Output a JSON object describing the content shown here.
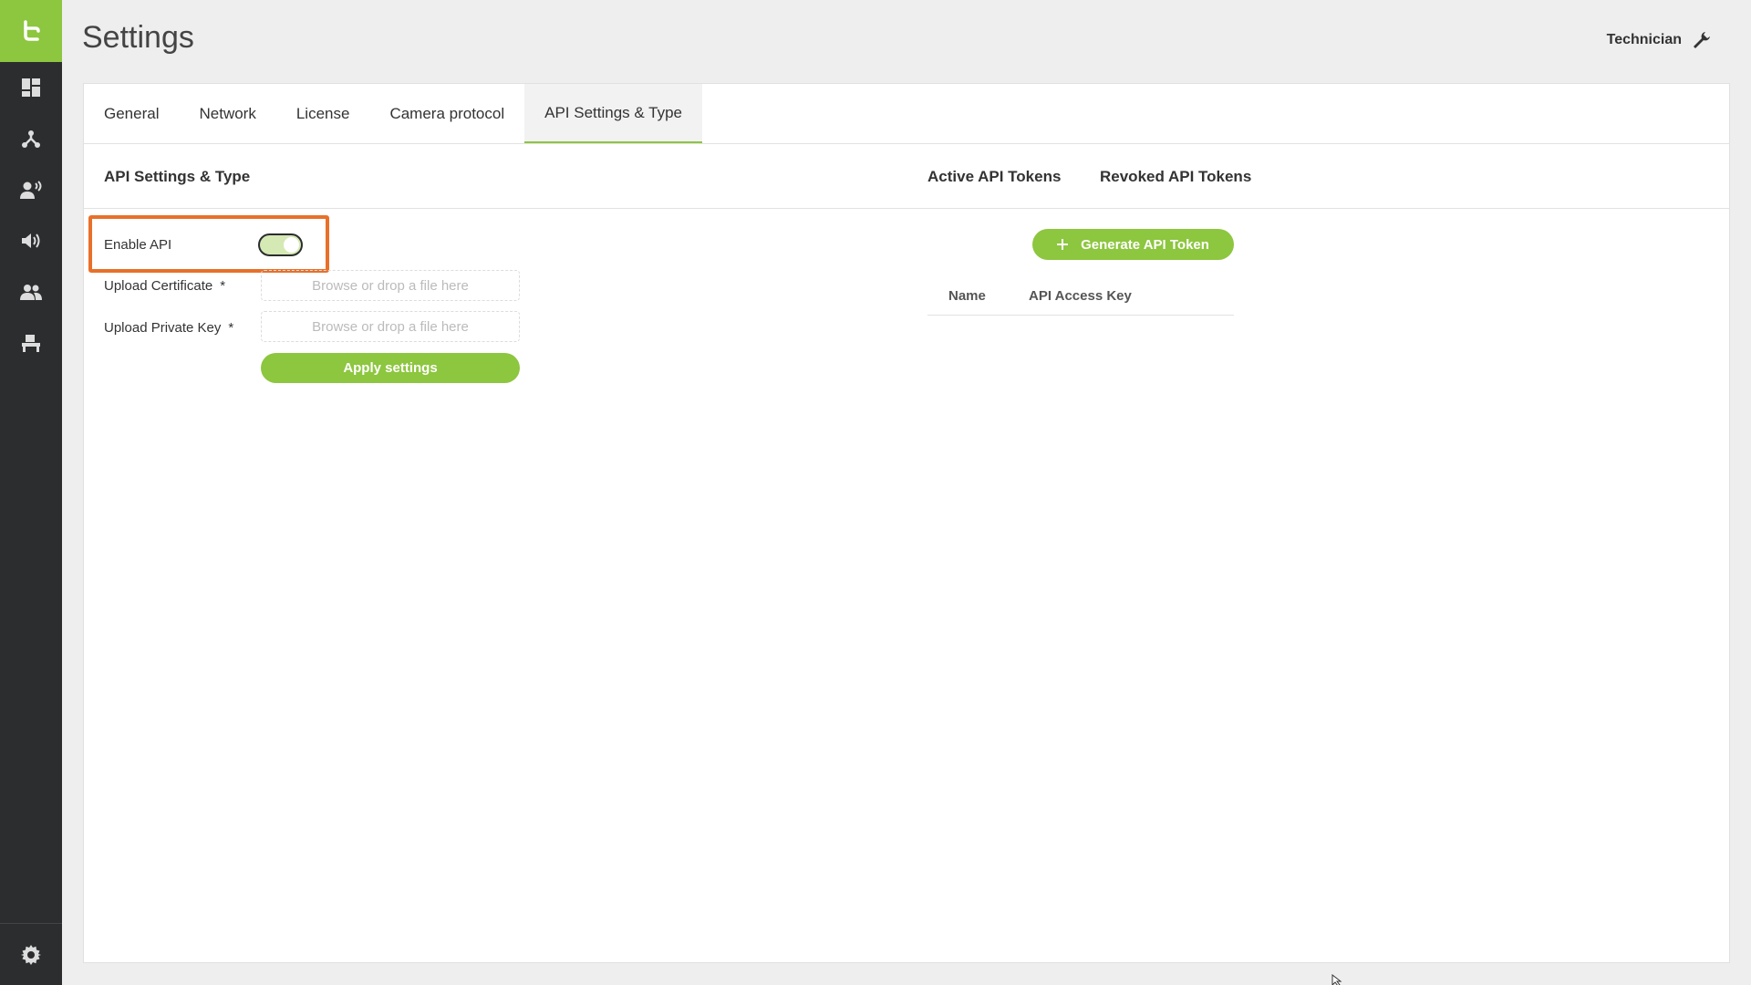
{
  "sidebar": {
    "logo_icon": "brand-logo-icon",
    "items": [
      {
        "icon": "dashboard-icon"
      },
      {
        "icon": "network-topology-icon"
      },
      {
        "icon": "speaker-person-icon"
      },
      {
        "icon": "volume-icon"
      },
      {
        "icon": "users-icon"
      },
      {
        "icon": "desk-icon"
      }
    ],
    "bottom_icon": "gear-icon"
  },
  "header": {
    "title": "Settings",
    "user_label": "Technician",
    "user_icon": "wrench-icon"
  },
  "tabs": [
    {
      "label": "General"
    },
    {
      "label": "Network"
    },
    {
      "label": "License"
    },
    {
      "label": "Camera protocol"
    },
    {
      "label": "API Settings & Type",
      "active": true
    }
  ],
  "section": {
    "title": "API Settings & Type",
    "token_tabs": [
      "Active API Tokens",
      "Revoked API Tokens"
    ]
  },
  "form": {
    "enable_api_label": "Enable API",
    "enable_api_on": true,
    "upload_cert_label": "Upload Certificate",
    "upload_key_label": "Upload Private Key",
    "required_mark": "*",
    "dropzone_placeholder": "Browse or drop a file here",
    "apply_label": "Apply settings"
  },
  "tokens": {
    "generate_label": "Generate API Token",
    "generate_icon": "plus-icon",
    "columns": [
      "Name",
      "API Access Key"
    ]
  },
  "colors": {
    "accent": "#8dc63f",
    "sidebar": "#2b2d2e",
    "highlight": "#e8702a"
  }
}
